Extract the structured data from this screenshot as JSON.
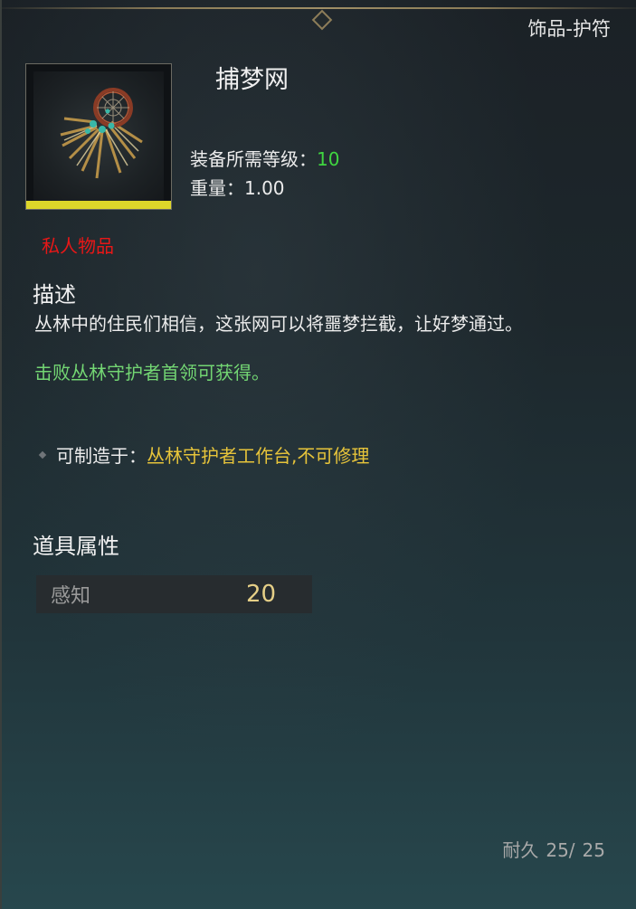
{
  "header": {
    "category": "饰品-护符"
  },
  "item": {
    "name": "捕梦网",
    "icon": "dreamcatcher-icon",
    "rarity_color": "#ddd62a",
    "level_label": "装备所需等级：",
    "level_value": "10",
    "weight_label": "重量：",
    "weight_value": "1.00",
    "private_tag": "私人物品"
  },
  "description": {
    "title": "描述",
    "text": "丛林中的住民们相信，这张网可以将噩梦拦截，让好梦通过。",
    "obtain": "击败丛林守护者首领可获得。"
  },
  "crafting": {
    "label": "可制造于：",
    "value": "丛林守护者工作台,不可修理"
  },
  "properties": {
    "title": "道具属性",
    "attributes": [
      {
        "name": "感知",
        "value": "20"
      }
    ]
  },
  "durability": {
    "label": "耐久",
    "current": "25/",
    "max": "25"
  },
  "colors": {
    "accent_gold": "#a08f66",
    "private_red": "#e81717",
    "obtain_green": "#73d673",
    "level_green": "#3fd640",
    "craft_yellow": "#e7c43a",
    "attr_value": "#e5cf87"
  }
}
